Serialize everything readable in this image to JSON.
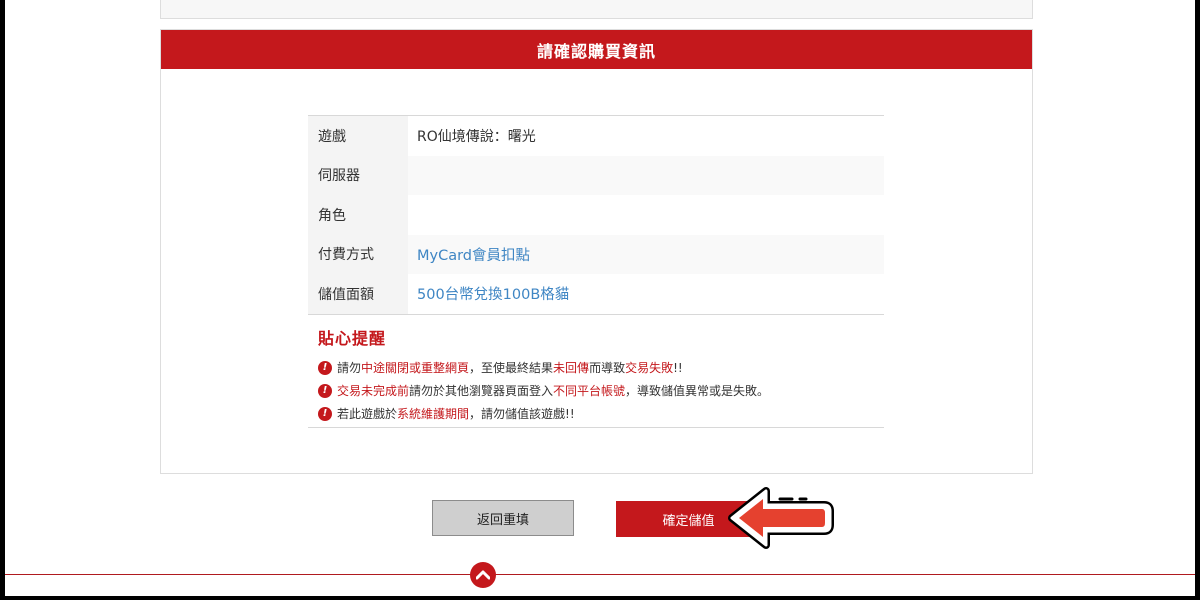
{
  "panel": {
    "title": "請確認購買資訊"
  },
  "info": [
    {
      "label": "遊戲",
      "value": "RO仙境傳說：曙光"
    },
    {
      "label": "伺服器",
      "value": ""
    },
    {
      "label": "角色",
      "value": ""
    },
    {
      "label": "付費方式",
      "value": "MyCard會員扣點"
    },
    {
      "label": "儲值面額",
      "value": "500台幣兌換100B格貓"
    }
  ],
  "notice": {
    "title": "貼心提醒",
    "line1": {
      "a": "請勿",
      "b": "中途關閉或重整網頁",
      "c": "，至使最終結果",
      "d": "未回傳",
      "e": "而導致",
      "f": "交易失敗",
      "g": "!!"
    },
    "line2": {
      "a": "交易未完成前",
      "b": "請勿於其他瀏覽器頁面登入",
      "c": "不同平台帳號",
      "d": "，導致儲值異常或是失敗。"
    },
    "line3": {
      "a": "若此遊戲於",
      "b": "系統維護期間",
      "c": "，請勿儲值該遊戲!!"
    }
  },
  "buttons": {
    "back": "返回重填",
    "confirm": "確定儲值"
  },
  "icons": {
    "warn": "warning-icon",
    "arrow": "pointer-arrow-icon",
    "top": "chevron-up-icon"
  },
  "colors": {
    "brand": "#c4181c",
    "link": "#3f86c4"
  }
}
